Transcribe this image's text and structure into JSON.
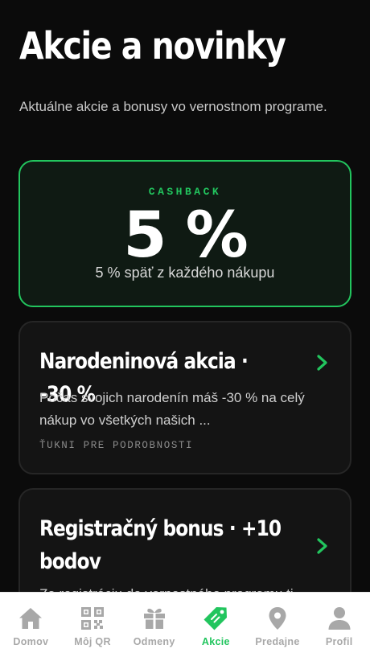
{
  "header": {
    "title": "Akcie a novinky",
    "subtitle": "Aktuálne akcie a bonusy vo vernostnom programe."
  },
  "cashback": {
    "label": "CASHBACK",
    "value": "5 %",
    "description": "5 % späť z každého nákupu"
  },
  "promotions": [
    {
      "title": "Narodeninová akcia · -30 %",
      "description": "Počas svojich narodenín máš -30 % na celý nákup vo všetkých našich ...",
      "hint": "ŤUKNI PRE PODROBNOSTI"
    },
    {
      "title": "Registračný bonus · +10 bodov",
      "description": "Za registráciu do vernostného programu ti"
    }
  ],
  "tabbar": {
    "items": [
      {
        "label": "Domov",
        "icon": "home-icon"
      },
      {
        "label": "Môj QR",
        "icon": "qr-icon"
      },
      {
        "label": "Odmeny",
        "icon": "gift-icon"
      },
      {
        "label": "Akcie",
        "icon": "tag-icon",
        "active": true
      },
      {
        "label": "Predajne",
        "icon": "location-icon"
      },
      {
        "label": "Profil",
        "icon": "user-icon"
      }
    ]
  },
  "colors": {
    "accent": "#22c55e",
    "background": "#0b0b0b",
    "card": "#141414",
    "inactive": "#a8a8a8"
  }
}
